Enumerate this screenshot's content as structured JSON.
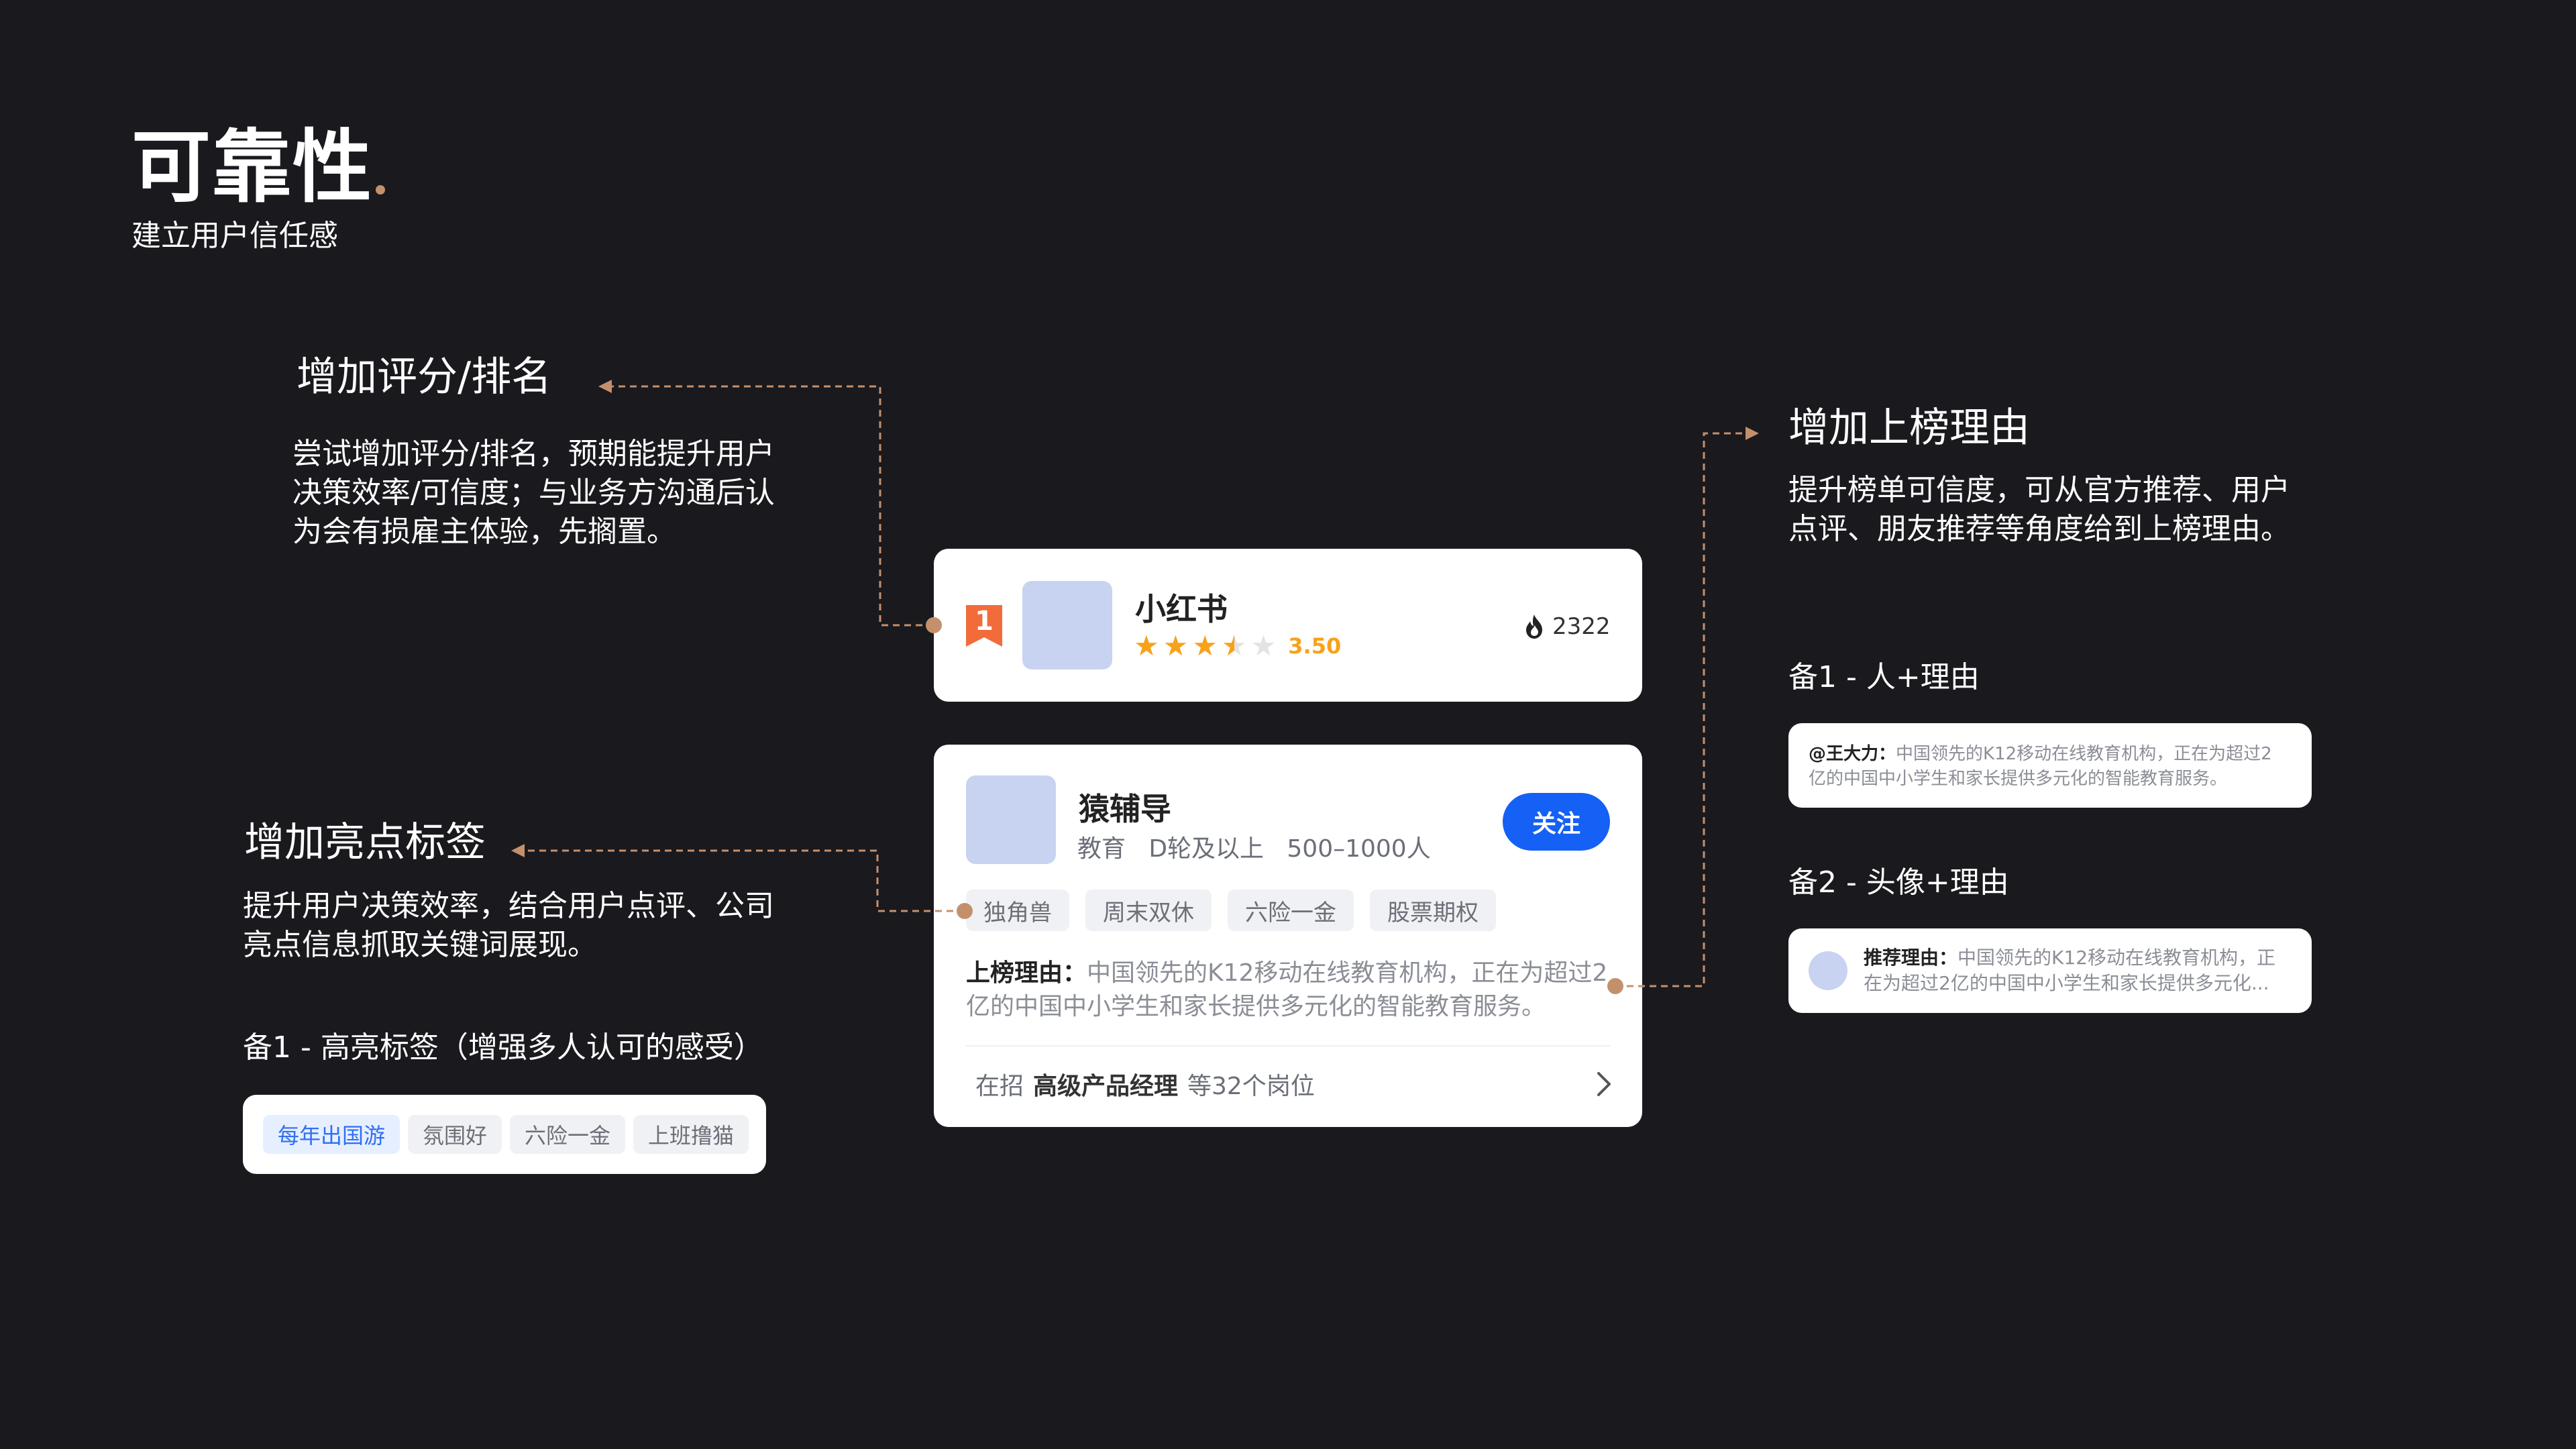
{
  "header": {
    "title": "可靠性",
    "subtitle": "建立用户信任感"
  },
  "rating_section": {
    "title": "增加评分/排名",
    "body": [
      "尝试增加评分/排名，预期能提升用户",
      "决策效率/可信度；与业务方沟通后认",
      "为会有损雇主体验，先搁置。"
    ]
  },
  "tags_section": {
    "title": "增加亮点标签",
    "body": [
      "提升用户决策效率，结合用户点评、公司",
      "亮点信息抓取关键词展现。"
    ],
    "alt_title": "备1 - 高亮标签（增强多人认可的感受）",
    "alt_tags": [
      "每年出国游",
      "氛围好",
      "六险一金",
      "上班撸猫"
    ]
  },
  "reason_section": {
    "title": "增加上榜理由",
    "body": [
      "提升榜单可信度，可从官方推荐、用户",
      "点评、朋友推荐等角度给到上榜理由。"
    ],
    "alt1_title": "备1 - 人+理由",
    "alt1_name": "@王大力：",
    "alt1_text_lines": [
      "中国领先的K12移动在线教育机构，正在为超过2",
      "亿的中国中小学生和家长提供多元化的智能教育服务。"
    ],
    "alt2_title": "备2 - 头像+理由",
    "alt2_label": "推荐理由：",
    "alt2_text_lines": [
      "中国领先的K12移动在线教育机构，正",
      "在为超过2亿的中国中小学生和家长提供多元化..."
    ]
  },
  "rank_card": {
    "rank": "1",
    "name": "小红书",
    "rating": 3.5,
    "rating_text": "3.50",
    "heat": "2322"
  },
  "company_card": {
    "name": "猿辅导",
    "meta": "教育   D轮及以上   500–1000人",
    "follow_label": "关注",
    "tags": [
      "独角兽",
      "周末双休",
      "六险一金",
      "股票期权"
    ],
    "reason_label": "上榜理由：",
    "reason_lines": [
      "中国领先的K12移动在线教育机构，正在为超过2",
      "亿的中国中小学生和家长提供多元化的智能教育服务。"
    ],
    "jobs_prefix": "在招",
    "jobs_role": "高级产品经理",
    "jobs_suffix": "等32个岗位"
  },
  "colors": {
    "background": "#1a191e",
    "accent": "#c4906c",
    "primary_blue": "#1560f5",
    "rank_orange": "#f26b3a",
    "star": "#f7a21b",
    "placeholder": "#c7d3f0"
  },
  "icons": [
    "rank-badge-icon",
    "star-icon",
    "flame-icon",
    "chevron-right-icon",
    "avatar-placeholder"
  ]
}
